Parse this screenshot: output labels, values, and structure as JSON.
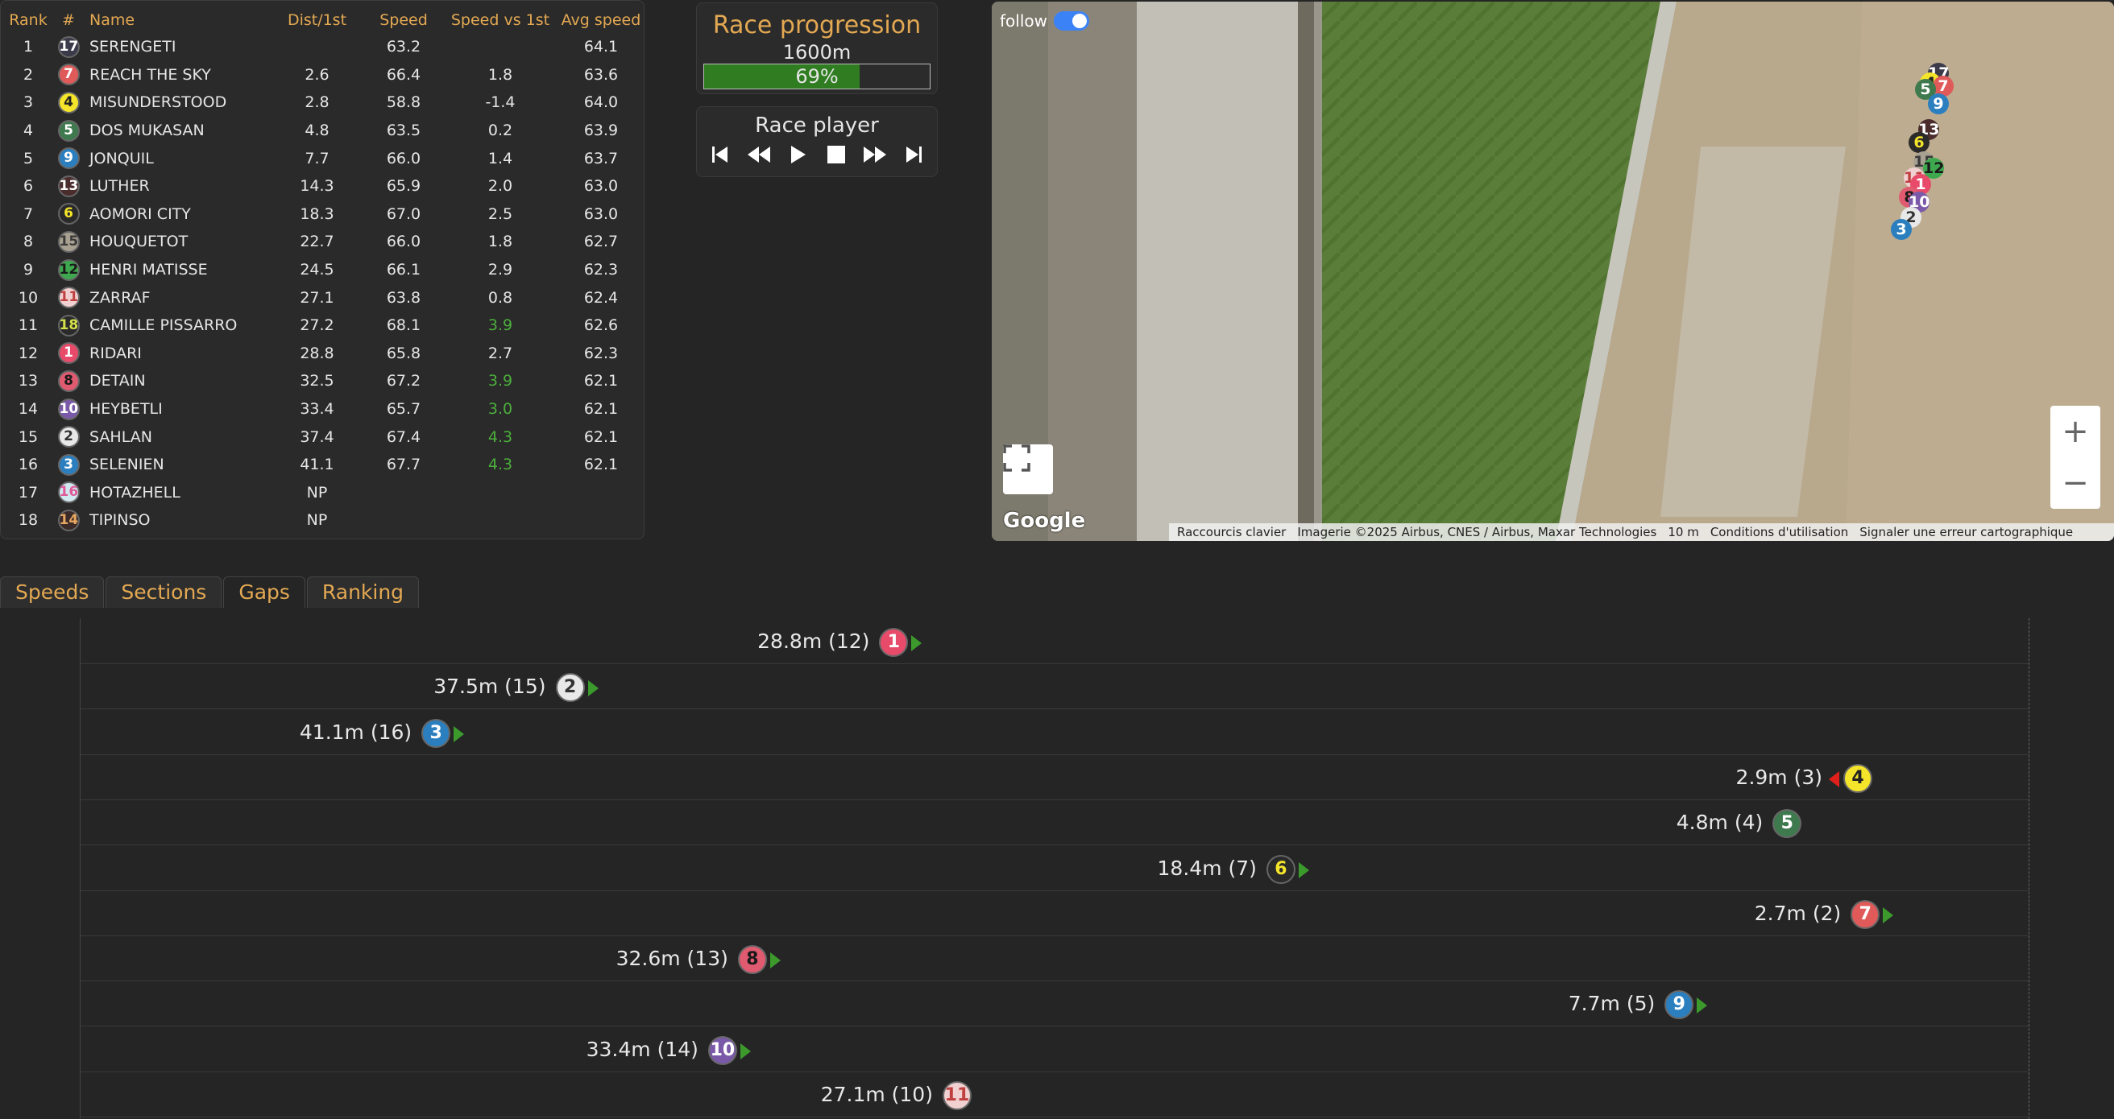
{
  "ranking": {
    "headers": {
      "rank": "Rank",
      "num": "#",
      "name": "Name",
      "dist": "Dist/1st",
      "speed": "Speed",
      "svs": "Speed vs 1st",
      "avg": "Avg speed"
    },
    "rows": [
      {
        "rank": "1",
        "num": "17",
        "name": "SERENGETI",
        "dist": "",
        "speed": "63.2",
        "svs": "",
        "svs_positive": false,
        "avg": "64.1",
        "bg": "#3a3a4a",
        "fg": "#ffffff"
      },
      {
        "rank": "2",
        "num": "7",
        "name": "REACH THE SKY",
        "dist": "2.6",
        "speed": "66.4",
        "svs": "1.8",
        "svs_positive": false,
        "avg": "63.6",
        "bg": "#e05a5a",
        "fg": "#ffffff"
      },
      {
        "rank": "3",
        "num": "4",
        "name": "MISUNDERSTOOD",
        "dist": "2.8",
        "speed": "58.8",
        "svs": "-1.4",
        "svs_positive": false,
        "avg": "64.0",
        "bg": "#f5e52a",
        "fg": "#222222"
      },
      {
        "rank": "4",
        "num": "5",
        "name": "DOS MUKASAN",
        "dist": "4.8",
        "speed": "63.5",
        "svs": "0.2",
        "svs_positive": false,
        "avg": "63.9",
        "bg": "#3e7a4e",
        "fg": "#ffffff"
      },
      {
        "rank": "5",
        "num": "9",
        "name": "JONQUIL",
        "dist": "7.7",
        "speed": "66.0",
        "svs": "1.4",
        "svs_positive": false,
        "avg": "63.7",
        "bg": "#2c7fbf",
        "fg": "#ffffff"
      },
      {
        "rank": "6",
        "num": "13",
        "name": "LUTHER",
        "dist": "14.3",
        "speed": "65.9",
        "svs": "2.0",
        "svs_positive": false,
        "avg": "63.0",
        "bg": "#4a2c2c",
        "fg": "#ffffff"
      },
      {
        "rank": "7",
        "num": "6",
        "name": "AOMORI CITY",
        "dist": "18.3",
        "speed": "67.0",
        "svs": "2.5",
        "svs_positive": false,
        "avg": "63.0",
        "bg": "#2a2a2a",
        "fg": "#f5e52a"
      },
      {
        "rank": "8",
        "num": "15",
        "name": "HOUQUETOT",
        "dist": "22.7",
        "speed": "66.0",
        "svs": "1.8",
        "svs_positive": false,
        "avg": "62.7",
        "bg": "#a8a090",
        "fg": "#3a3a3a"
      },
      {
        "rank": "9",
        "num": "12",
        "name": "HENRI MATISSE",
        "dist": "24.5",
        "speed": "66.1",
        "svs": "2.9",
        "svs_positive": false,
        "avg": "62.3",
        "bg": "#3ea84e",
        "fg": "#1a1a1a"
      },
      {
        "rank": "10",
        "num": "11",
        "name": "ZARRAF",
        "dist": "27.1",
        "speed": "63.8",
        "svs": "0.8",
        "svs_positive": false,
        "avg": "62.4",
        "bg": "#f0d0d0",
        "fg": "#c04040"
      },
      {
        "rank": "11",
        "num": "18",
        "name": "CAMILLE PISSARRO",
        "dist": "27.2",
        "speed": "68.1",
        "svs": "3.9",
        "svs_positive": true,
        "avg": "62.6",
        "bg": "#2a2a2a",
        "fg": "#d4e04a"
      },
      {
        "rank": "12",
        "num": "1",
        "name": "RIDARI",
        "dist": "28.8",
        "speed": "65.8",
        "svs": "2.7",
        "svs_positive": false,
        "avg": "62.3",
        "bg": "#e84a6a",
        "fg": "#ffffff"
      },
      {
        "rank": "13",
        "num": "8",
        "name": "DETAIN",
        "dist": "32.5",
        "speed": "67.2",
        "svs": "3.9",
        "svs_positive": true,
        "avg": "62.1",
        "bg": "#e05a70",
        "fg": "#1a1a1a"
      },
      {
        "rank": "14",
        "num": "10",
        "name": "HEYBETLI",
        "dist": "33.4",
        "speed": "65.7",
        "svs": "3.0",
        "svs_positive": true,
        "avg": "62.1",
        "bg": "#7a5aa8",
        "fg": "#ffffff"
      },
      {
        "rank": "15",
        "num": "2",
        "name": "SAHLAN",
        "dist": "37.4",
        "speed": "67.4",
        "svs": "4.3",
        "svs_positive": true,
        "avg": "62.1",
        "bg": "#e8e8e8",
        "fg": "#333333"
      },
      {
        "rank": "16",
        "num": "3",
        "name": "SELENIEN",
        "dist": "41.1",
        "speed": "67.7",
        "svs": "4.3",
        "svs_positive": true,
        "avg": "62.1",
        "bg": "#2c7fbf",
        "fg": "#ffffff"
      },
      {
        "rank": "17",
        "num": "16",
        "name": "HOTAZHELL",
        "dist": "NP",
        "speed": "",
        "svs": "",
        "svs_positive": false,
        "avg": "",
        "bg": "#d0e8f0",
        "fg": "#e05a9a"
      },
      {
        "rank": "18",
        "num": "14",
        "name": "TIPINSO",
        "dist": "NP",
        "speed": "",
        "svs": "",
        "svs_positive": false,
        "avg": "",
        "bg": "#3a2a2a",
        "fg": "#e8a860"
      }
    ]
  },
  "progression": {
    "title": "Race progression",
    "distance": "1600m",
    "percent_label": "69%",
    "percent": 0.69
  },
  "player": {
    "title": "Race player",
    "buttons": [
      "skip-start-icon",
      "rewind-icon",
      "play-icon",
      "stop-icon",
      "fast-forward-icon",
      "skip-end-icon"
    ]
  },
  "map": {
    "follow_label": "follow",
    "zoom_in": "+",
    "zoom_out": "−",
    "google": "Google",
    "attribution": [
      "Raccourcis clavier",
      "Imagerie ©2025 Airbus, CNES / Airbus, Maxar Technologies",
      "10 m",
      "Conditions d'utilisation",
      "Signaler une erreur cartographique"
    ],
    "markers": [
      "17",
      "4",
      "7",
      "5",
      "9",
      "13",
      "6",
      "15",
      "12",
      "11",
      "1",
      "8",
      "10",
      "2",
      "3"
    ]
  },
  "tabs": [
    {
      "label": "Speeds",
      "active": false
    },
    {
      "label": "Sections",
      "active": false
    },
    {
      "label": "Gaps",
      "active": true
    },
    {
      "label": "Ranking",
      "active": false
    }
  ],
  "gaps": [
    {
      "num": "1",
      "label": "28.8m (12)",
      "gap": 28.8,
      "trend": "up",
      "bg": "#e84a6a",
      "fg": "#ffffff"
    },
    {
      "num": "2",
      "label": "37.5m (15)",
      "gap": 37.5,
      "trend": "up",
      "bg": "#e8e8e8",
      "fg": "#333333"
    },
    {
      "num": "3",
      "label": "41.1m (16)",
      "gap": 41.1,
      "trend": "up",
      "bg": "#2c7fbf",
      "fg": "#ffffff"
    },
    {
      "num": "4",
      "label": "2.9m (3)",
      "gap": 2.9,
      "trend": "down",
      "bg": "#f5e52a",
      "fg": "#222222"
    },
    {
      "num": "5",
      "label": "4.8m (4)",
      "gap": 4.8,
      "trend": "none",
      "bg": "#3e7a4e",
      "fg": "#ffffff"
    },
    {
      "num": "6",
      "label": "18.4m (7)",
      "gap": 18.4,
      "trend": "up",
      "bg": "#2a2a2a",
      "fg": "#f5e52a"
    },
    {
      "num": "7",
      "label": "2.7m (2)",
      "gap": 2.7,
      "trend": "up",
      "bg": "#e05a5a",
      "fg": "#ffffff"
    },
    {
      "num": "8",
      "label": "32.6m (13)",
      "gap": 32.6,
      "trend": "up",
      "bg": "#e05a70",
      "fg": "#1a1a1a"
    },
    {
      "num": "9",
      "label": "7.7m (5)",
      "gap": 7.7,
      "trend": "up",
      "bg": "#2c7fbf",
      "fg": "#ffffff"
    },
    {
      "num": "10",
      "label": "33.4m (14)",
      "gap": 33.4,
      "trend": "up",
      "bg": "#7a5aa8",
      "fg": "#ffffff"
    },
    {
      "num": "11",
      "label": "27.1m (10)",
      "gap": 27.1,
      "trend": "none",
      "bg": "#f0d0d0",
      "fg": "#c04040"
    }
  ]
}
